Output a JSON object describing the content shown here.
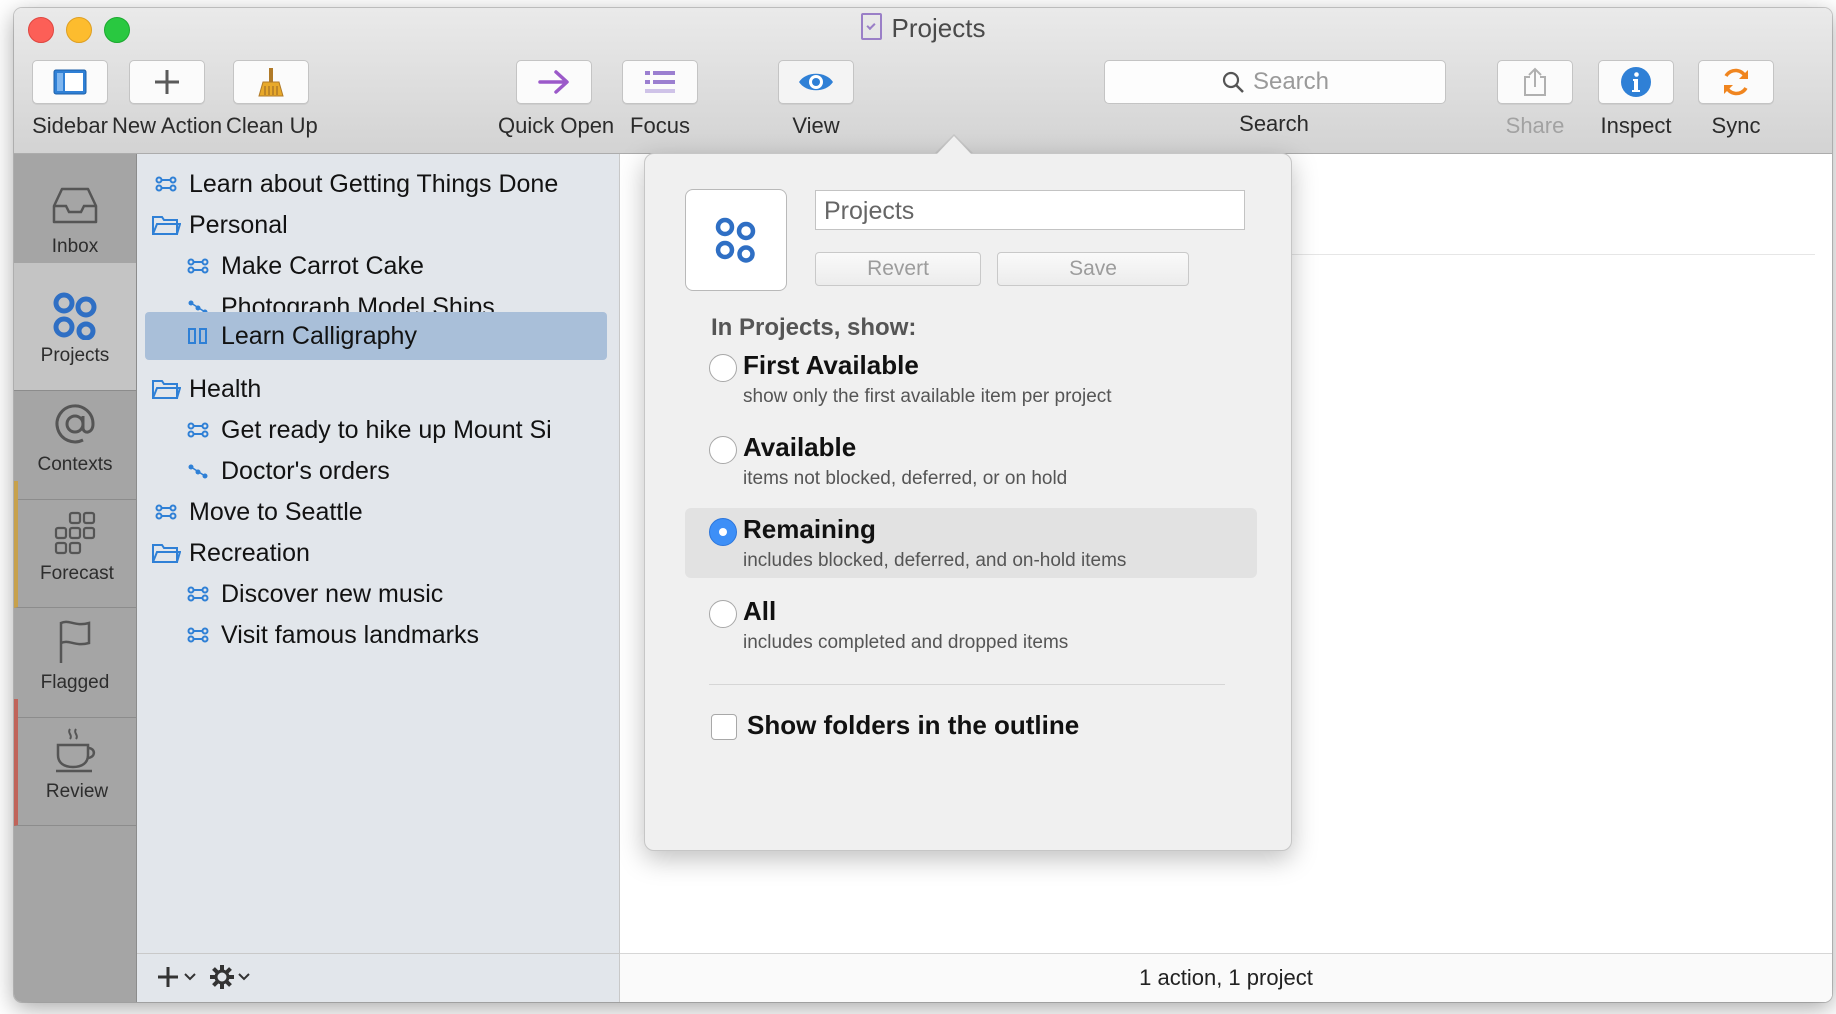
{
  "window": {
    "title": "Projects"
  },
  "toolbar": {
    "sidebar_label": "Sidebar",
    "new_action_label": "New Action",
    "clean_up_label": "Clean Up",
    "quick_open_label": "Quick Open",
    "focus_label": "Focus",
    "view_label": "View",
    "search_placeholder": "Search",
    "search_label": "Search",
    "share_label": "Share",
    "inspect_label": "Inspect",
    "sync_label": "Sync"
  },
  "perspectives": [
    {
      "label": "Inbox",
      "icon": "inbox-icon"
    },
    {
      "label": "Projects",
      "icon": "projects-icon"
    },
    {
      "label": "Contexts",
      "icon": "at-sign-icon"
    },
    {
      "label": "Forecast",
      "icon": "calendar-grid-icon"
    },
    {
      "label": "Flagged",
      "icon": "flag-icon"
    },
    {
      "label": "Review",
      "icon": "coffee-cup-icon"
    }
  ],
  "sidebar": {
    "items": [
      {
        "label": "Learn about Getting Things Done",
        "icon": "parallel-project-icon"
      },
      {
        "label": "Personal",
        "icon": "folder-icon"
      },
      {
        "label": "Make Carrot Cake",
        "icon": "parallel-project-icon"
      },
      {
        "label": "Photograph Model Ships",
        "icon": "sequential-project-icon"
      },
      {
        "label": "Learn Calligraphy",
        "icon": "single-actions-icon"
      },
      {
        "label": "Health",
        "icon": "folder-icon"
      },
      {
        "label": "Get ready to hike up Mount Si",
        "icon": "parallel-project-icon"
      },
      {
        "label": "Doctor's orders",
        "icon": "sequential-project-icon"
      },
      {
        "label": "Move to Seattle",
        "icon": "parallel-project-icon"
      },
      {
        "label": "Recreation",
        "icon": "folder-icon"
      },
      {
        "label": "Discover new music",
        "icon": "parallel-project-icon"
      },
      {
        "label": "Visit famous landmarks",
        "icon": "parallel-project-icon"
      }
    ]
  },
  "popover": {
    "name_value": "Projects",
    "revert_label": "Revert",
    "save_label": "Save",
    "heading": "In Projects, show:",
    "options": [
      {
        "title": "First Available",
        "desc": "show only the first available item per project"
      },
      {
        "title": "Available",
        "desc": "items not blocked, deferred, or on hold"
      },
      {
        "title": "Remaining",
        "desc": "includes blocked, deferred, and on-hold items"
      },
      {
        "title": "All",
        "desc": "includes completed and dropped items"
      }
    ],
    "show_folders_label": "Show folders in the outline"
  },
  "status": {
    "text": "1 action, 1 project"
  },
  "colors": {
    "accent": "#3d8ff7",
    "selection": "#a9bfd9",
    "projects_blue": "#2f6fc4"
  }
}
